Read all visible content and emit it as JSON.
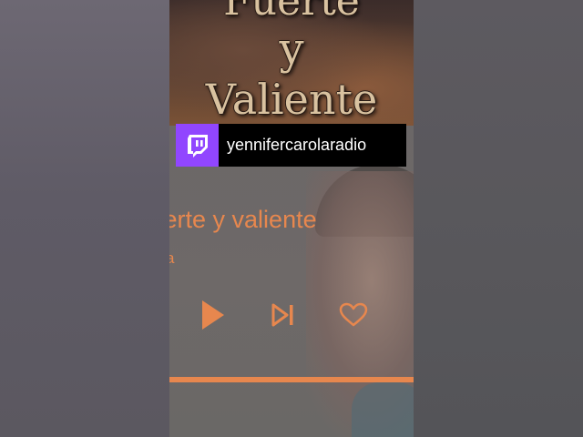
{
  "cover": {
    "line1": "Fuerte",
    "line2": "y",
    "line3": "Valiente"
  },
  "player": {
    "song_title": "Fuerte y valiente",
    "artist": "a",
    "progress": 1.0,
    "icons": [
      "play-icon",
      "skip-next-icon",
      "heart-icon"
    ],
    "accent_color": "#e7874e"
  },
  "twitch": {
    "channel": "yennifercarolaradio",
    "brand_color": "#9146ff",
    "logo_icon": "twitch-icon"
  }
}
